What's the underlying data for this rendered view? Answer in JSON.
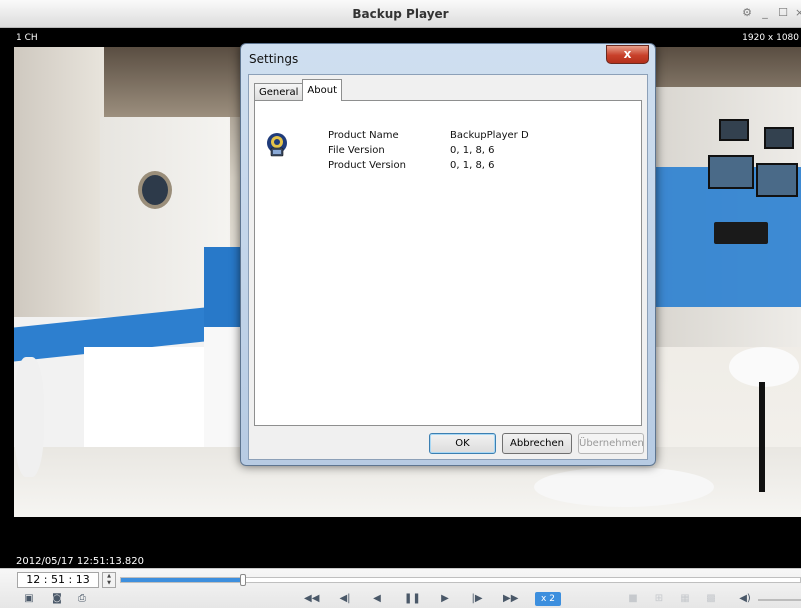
{
  "window": {
    "title": "Backup Player",
    "controls": [
      "gear-icon",
      "minimize-icon",
      "maximize-icon",
      "close-icon"
    ]
  },
  "video": {
    "channel_label": "1 CH",
    "resolution": "1920 x 1080",
    "timestamp": "2012/05/17 12:51:13.820"
  },
  "dialog": {
    "title": "Settings",
    "close_glyph": "x",
    "tabs": [
      {
        "label": "General",
        "active": false
      },
      {
        "label": "About",
        "active": true
      }
    ],
    "about": {
      "icon": "app-icon",
      "rows": [
        {
          "label": "Product Name",
          "value": "BackupPlayer D"
        },
        {
          "label": "File Version",
          "value": "0, 1, 8, 6"
        },
        {
          "label": "Product Version",
          "value": "0, 1, 8, 6"
        }
      ]
    },
    "buttons": {
      "ok": "OK",
      "cancel": "Abbrechen",
      "apply": "Übernehmen"
    }
  },
  "playback": {
    "time_value": "12 : 51 : 13",
    "position_fraction": 0.18,
    "speed_label": "x 2",
    "left_icons": [
      "layout-icon",
      "snapshot-icon",
      "print-icon"
    ],
    "transport_icons": [
      "fast-rewind-icon",
      "step-back-icon",
      "reverse-play-icon",
      "pause-icon",
      "play-icon",
      "step-forward-icon",
      "fast-forward-icon"
    ],
    "layout_icons": [
      "single-view-icon",
      "quad-view-icon",
      "nine-view-icon",
      "sixteen-view-icon"
    ],
    "volume_icon": "volume-icon",
    "accent_color": "#3d8fde"
  }
}
